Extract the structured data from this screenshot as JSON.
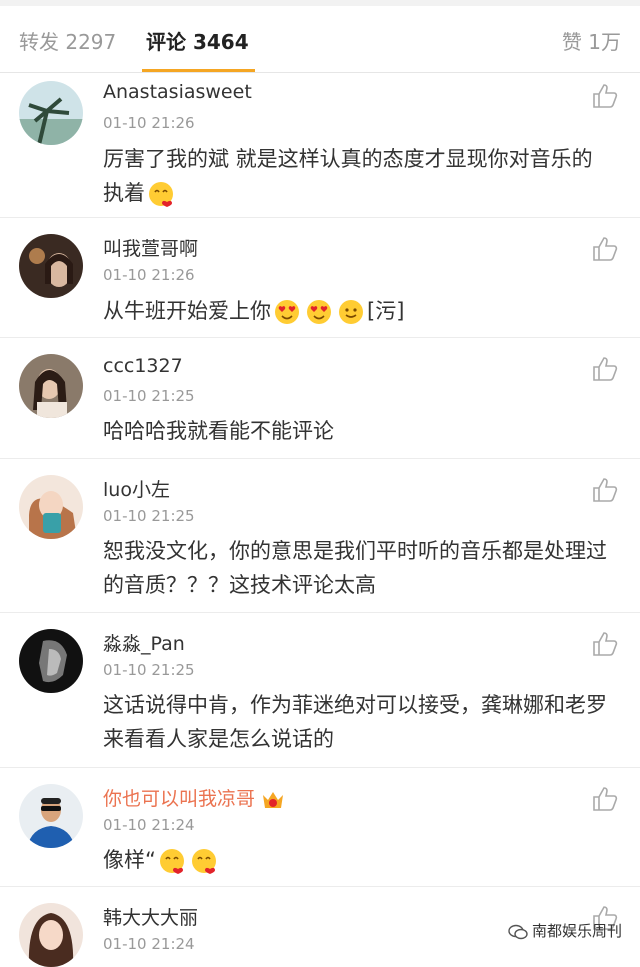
{
  "tabs": {
    "repost": "转发 2297",
    "comment": "评论 3464",
    "like": "赞 1万"
  },
  "comments": [
    {
      "name": "Anastasiasweet",
      "time": "01-10 21:26",
      "text": "厉害了我的斌  就是这样认真的态度才显现你对音乐的执着",
      "emojis": [
        "love-face"
      ]
    },
    {
      "name": "叫我萱哥啊",
      "time": "01-10 21:26",
      "text": "从牛班开始爱上你",
      "emojis": [
        "heart-eyes",
        "heart-eyes",
        "smile"
      ],
      "suffix": "[污]"
    },
    {
      "name": "ccc1327",
      "time": "01-10 21:25",
      "text": "哈哈哈我就看能不能评论",
      "emojis": []
    },
    {
      "name": "luo小左",
      "time": "01-10 21:25",
      "text": "恕我没文化，你的意思是我们平时听的音乐都是处理过的音质？？？这技术评论太高",
      "emojis": []
    },
    {
      "name": "淼淼_Pan",
      "time": "01-10 21:25",
      "text": "这话说得中肯，作为菲迷绝对可以接受，龚琳娜和老罗来看看人家是怎么说话的",
      "emojis": []
    },
    {
      "name": "你也可以叫我凉哥",
      "time": "01-10 21:24",
      "text": "像样“",
      "emojis": [
        "love-face",
        "love-face"
      ],
      "vip": true
    },
    {
      "name": "韩大大大丽",
      "time": "01-10 21:24",
      "text": "",
      "emojis": []
    }
  ],
  "watermark": "南都娱乐周刊",
  "colors": {
    "accent": "#f5a623",
    "vip_name": "#eb7350",
    "muted": "#999999"
  }
}
